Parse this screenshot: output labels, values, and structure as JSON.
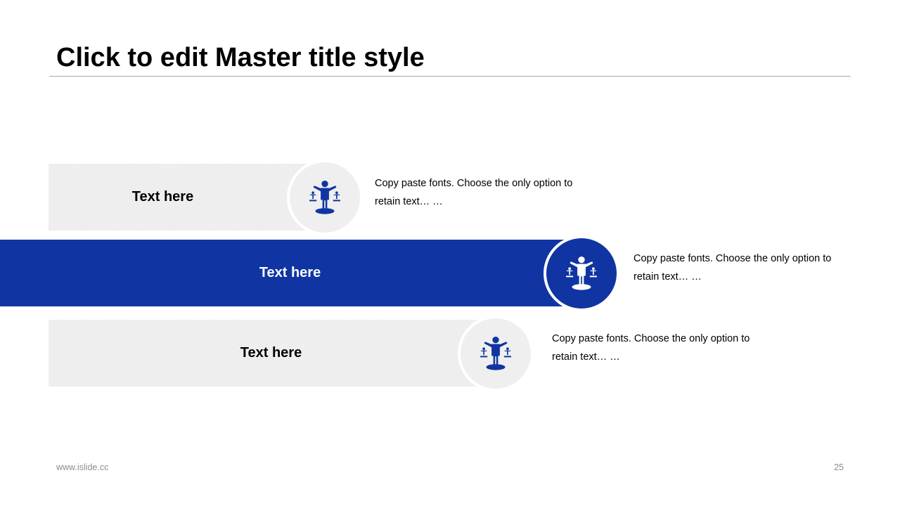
{
  "slide": {
    "title": "Click to edit Master title style",
    "accent_color": "#1035a2",
    "light_color": "#f0f0f0",
    "items": [
      {
        "label": "Text here",
        "description": "Copy paste fonts. Choose the only option to retain text… …",
        "icon": "justice-figure-icon",
        "style": "light"
      },
      {
        "label": "Text here",
        "description": "Copy paste fonts. Choose the only option to retain text… …",
        "icon": "justice-figure-icon",
        "style": "dark"
      },
      {
        "label": "Text here",
        "description": "Copy paste fonts. Choose the only option to retain text… …",
        "icon": "justice-figure-icon",
        "style": "light"
      }
    ]
  },
  "footer": {
    "website": "www.islide.cc",
    "page_number": "25"
  }
}
